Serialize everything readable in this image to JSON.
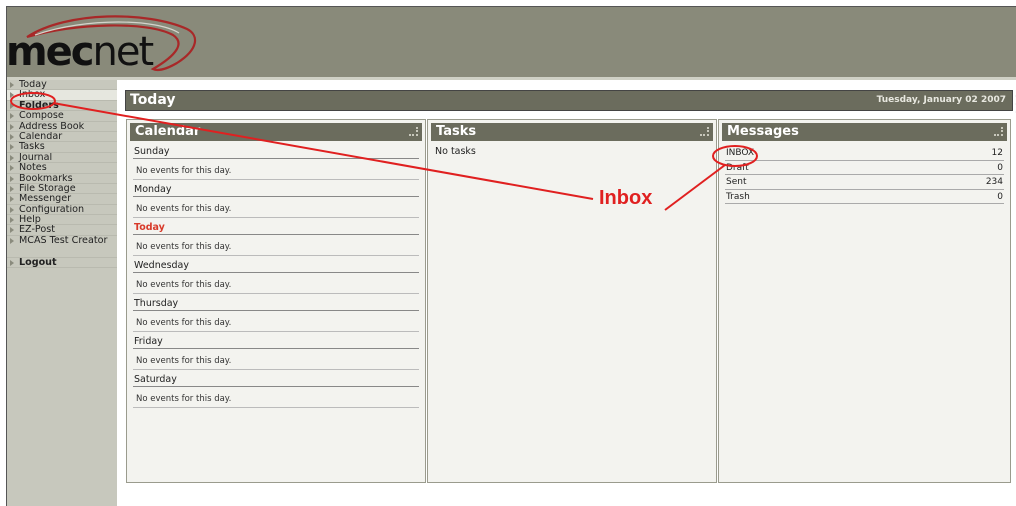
{
  "app": {
    "logo_main": "mec",
    "logo_suffix": "net"
  },
  "sidebar": {
    "items": [
      {
        "label": "Today"
      },
      {
        "label": "Inbox"
      },
      {
        "label": "Folders"
      },
      {
        "label": "Compose"
      },
      {
        "label": "Address Book"
      },
      {
        "label": "Calendar"
      },
      {
        "label": "Tasks"
      },
      {
        "label": "Journal"
      },
      {
        "label": "Notes"
      },
      {
        "label": "Bookmarks"
      },
      {
        "label": "File Storage"
      },
      {
        "label": "Messenger"
      },
      {
        "label": "Configuration"
      },
      {
        "label": "Help"
      },
      {
        "label": "EZ-Post"
      },
      {
        "label": "MCAS Test Creator"
      },
      {
        "label": "Logout"
      }
    ]
  },
  "page": {
    "title": "Today",
    "date": "Tuesday, January 02 2007"
  },
  "calendar": {
    "title": "Calendar",
    "days": [
      {
        "name": "Sunday",
        "events": "No events for this day."
      },
      {
        "name": "Monday",
        "events": "No events for this day."
      },
      {
        "name": "Today",
        "events": "No events for this day."
      },
      {
        "name": "Wednesday",
        "events": "No events for this day."
      },
      {
        "name": "Thursday",
        "events": "No events for this day."
      },
      {
        "name": "Friday",
        "events": "No events for this day."
      },
      {
        "name": "Saturday",
        "events": "No events for this day."
      }
    ]
  },
  "tasks": {
    "title": "Tasks",
    "empty_text": "No tasks"
  },
  "messages": {
    "title": "Messages",
    "folders": [
      {
        "name": "INBOX",
        "count": "12"
      },
      {
        "name": "Draft",
        "count": "0"
      },
      {
        "name": "Sent",
        "count": "234"
      },
      {
        "name": "Trash",
        "count": "0"
      }
    ]
  },
  "annotation": {
    "callout_label": "Inbox",
    "color": "#e02020"
  },
  "colors": {
    "header_bg": "#898a7a",
    "panel_header_bg": "#6b6c5d",
    "sidebar_bg": "#c7c8bd",
    "today_accent": "#d83a2a"
  }
}
